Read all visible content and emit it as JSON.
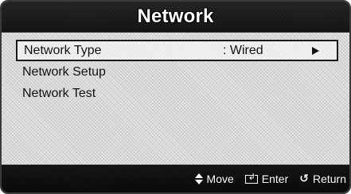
{
  "window": {
    "title": "Network"
  },
  "menu": {
    "items": [
      {
        "label": "Network Type",
        "value": ": Wired",
        "selected": true,
        "has_submenu": true
      },
      {
        "label": "Network Setup"
      },
      {
        "label": "Network Test"
      }
    ]
  },
  "footer": {
    "hints": [
      {
        "icon": "up-down-arrows-icon",
        "label": "Move"
      },
      {
        "icon": "enter-icon",
        "label": "Enter"
      },
      {
        "icon": "return-icon",
        "label": "Return"
      }
    ]
  }
}
